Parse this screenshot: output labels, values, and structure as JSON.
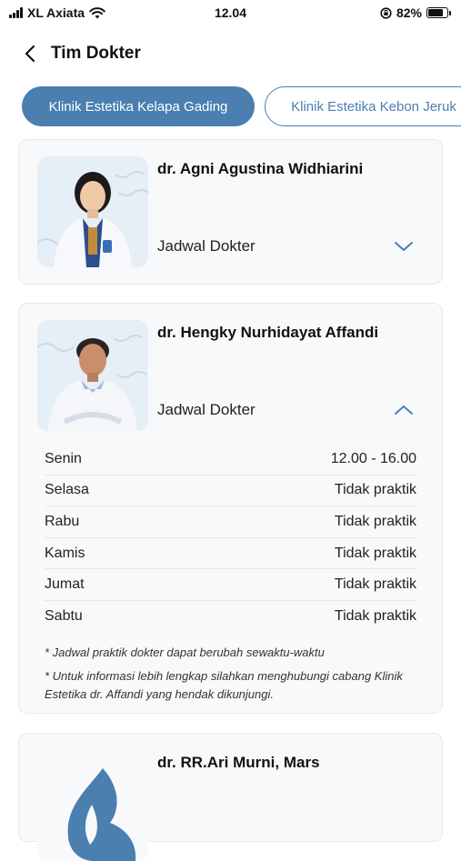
{
  "status_bar": {
    "carrier": "XL Axiata",
    "time": "12.04",
    "battery_percent": "82%",
    "battery_level": 0.82
  },
  "header": {
    "back_icon": "chevron-left-icon",
    "title": "Tim Dokter"
  },
  "tabs": [
    {
      "label": "Klinik Estetika Kelapa Gading",
      "active": true
    },
    {
      "label": "Klinik Estetika Kebon Jeruk",
      "active": false
    }
  ],
  "doctors": [
    {
      "name": "dr. Agni Agustina Widhiarini",
      "schedule_label": "Jadwal Dokter",
      "expanded": false
    },
    {
      "name": "dr. Hengky Nurhidayat Affandi",
      "schedule_label": "Jadwal Dokter",
      "expanded": true,
      "schedule": [
        {
          "day": "Senin",
          "time": "12.00 - 16.00"
        },
        {
          "day": "Selasa",
          "time": "Tidak praktik"
        },
        {
          "day": "Rabu",
          "time": "Tidak praktik"
        },
        {
          "day": "Kamis",
          "time": "Tidak praktik"
        },
        {
          "day": "Jumat",
          "time": "Tidak praktik"
        },
        {
          "day": "Sabtu",
          "time": "Tidak praktik"
        }
      ],
      "notes": [
        "* Jadwal praktik dokter dapat berubah sewaktu-waktu",
        "* Untuk informasi lebih lengkap silahkan menghubungi cabang Klinik Estetika dr. Affandi yang hendak dikunjungi."
      ]
    },
    {
      "name": "dr. RR.Ari Murni, Mars"
    }
  ],
  "colors": {
    "accent": "#4a7fb0",
    "card_bg": "#f8f9fb"
  }
}
